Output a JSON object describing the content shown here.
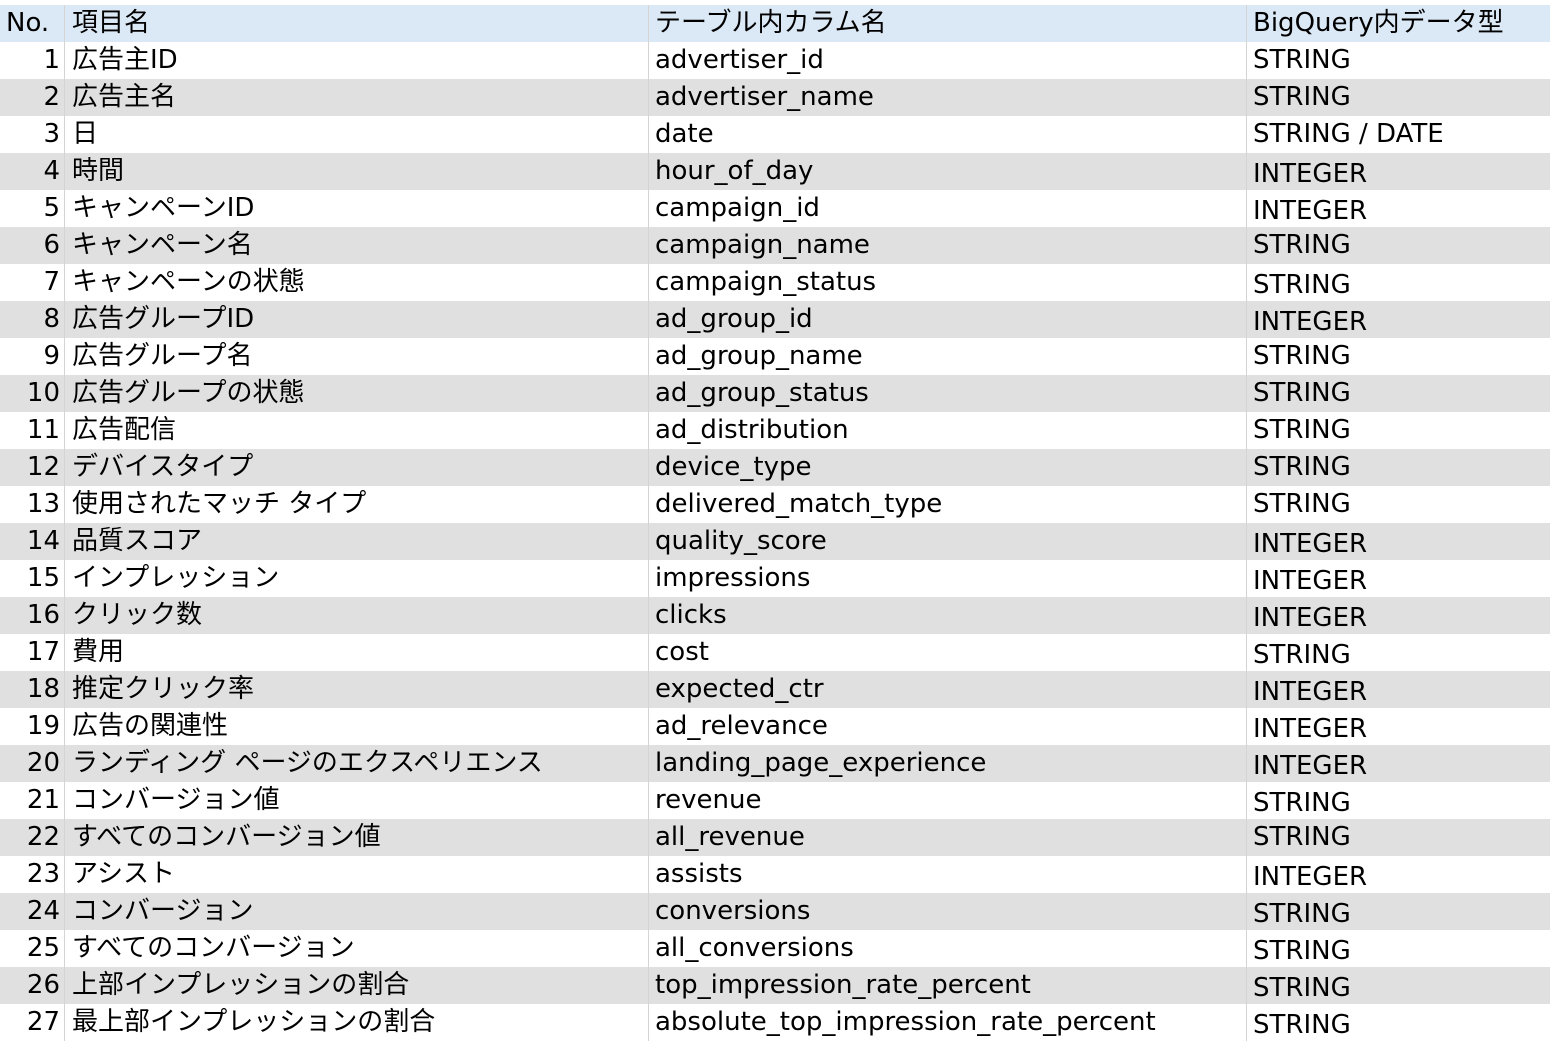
{
  "header": {
    "no": "No.",
    "name": "項目名",
    "column": "テーブル内カラム名",
    "type": "BigQuery内データ型"
  },
  "rows": [
    {
      "no": "1",
      "name": "広告主ID",
      "column": "advertiser_id",
      "type": "STRING"
    },
    {
      "no": "2",
      "name": "広告主名",
      "column": "advertiser_name",
      "type": "STRING"
    },
    {
      "no": "3",
      "name": "日",
      "column": "date",
      "type": "STRING / DATE"
    },
    {
      "no": "4",
      "name": "時間",
      "column": "hour_of_day",
      "type": "INTEGER"
    },
    {
      "no": "5",
      "name": "キャンペーンID",
      "column": "campaign_id",
      "type": "INTEGER"
    },
    {
      "no": "6",
      "name": "キャンペーン名",
      "column": "campaign_name",
      "type": "STRING"
    },
    {
      "no": "7",
      "name": "キャンペーンの状態",
      "column": "campaign_status",
      "type": "STRING"
    },
    {
      "no": "8",
      "name": "広告グループID",
      "column": "ad_group_id",
      "type": "INTEGER"
    },
    {
      "no": "9",
      "name": "広告グループ名",
      "column": "ad_group_name",
      "type": "STRING"
    },
    {
      "no": "10",
      "name": "広告グループの状態",
      "column": "ad_group_status",
      "type": "STRING"
    },
    {
      "no": "11",
      "name": "広告配信",
      "column": "ad_distribution",
      "type": "STRING"
    },
    {
      "no": "12",
      "name": "デバイスタイプ",
      "column": "device_type",
      "type": "STRING"
    },
    {
      "no": "13",
      "name": "使用されたマッチ タイプ",
      "column": "delivered_match_type",
      "type": "STRING"
    },
    {
      "no": "14",
      "name": "品質スコア",
      "column": "quality_score",
      "type": "INTEGER"
    },
    {
      "no": "15",
      "name": "インプレッション",
      "column": "impressions",
      "type": "INTEGER"
    },
    {
      "no": "16",
      "name": "クリック数",
      "column": "clicks",
      "type": "INTEGER"
    },
    {
      "no": "17",
      "name": "費用",
      "column": "cost",
      "type": "STRING"
    },
    {
      "no": "18",
      "name": "推定クリック率",
      "column": "expected_ctr",
      "type": "INTEGER"
    },
    {
      "no": "19",
      "name": "広告の関連性",
      "column": "ad_relevance",
      "type": "INTEGER"
    },
    {
      "no": "20",
      "name": "ランディング ページのエクスペリエンス",
      "column": "landing_page_experience",
      "type": "INTEGER"
    },
    {
      "no": "21",
      "name": "コンバージョン値",
      "column": "revenue",
      "type": "STRING"
    },
    {
      "no": "22",
      "name": "すべてのコンバージョン値",
      "column": "all_revenue",
      "type": "STRING"
    },
    {
      "no": "23",
      "name": "アシスト",
      "column": "assists",
      "type": "INTEGER"
    },
    {
      "no": "24",
      "name": "コンバージョン",
      "column": "conversions",
      "type": "STRING"
    },
    {
      "no": "25",
      "name": "すべてのコンバージョン",
      "column": "all_conversions",
      "type": "STRING"
    },
    {
      "no": "26",
      "name": "上部インプレッションの割合",
      "column": "top_impression_rate_percent",
      "type": "STRING"
    },
    {
      "no": "27",
      "name": "最上部インプレッションの割合",
      "column": "absolute_top_impression_rate_percent",
      "type": "STRING"
    }
  ]
}
